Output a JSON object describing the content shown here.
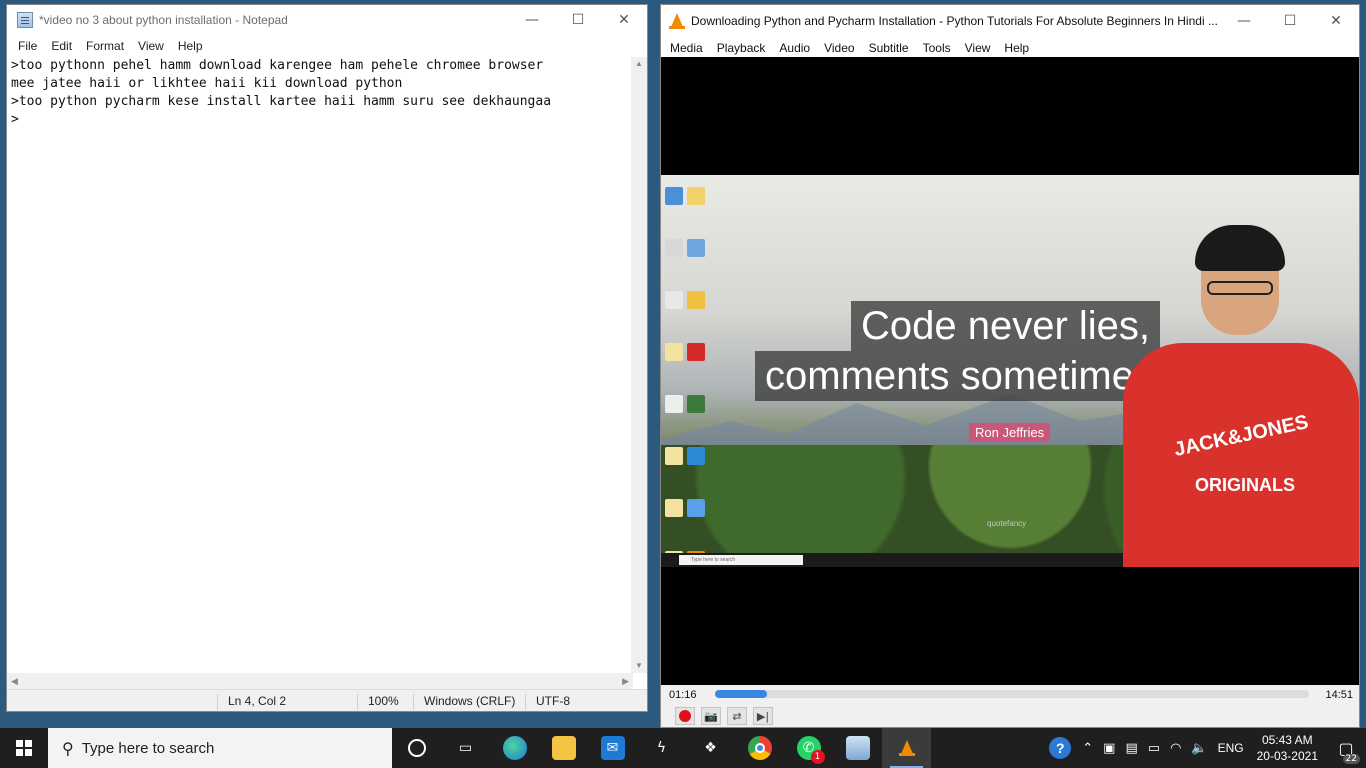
{
  "notepad": {
    "title": "*video no 3 about python installation - Notepad",
    "menu": [
      "File",
      "Edit",
      "Format",
      "View",
      "Help"
    ],
    "content": ">too pythonn pehel hamm download karengee ham pehele chromee browser\nmee jatee haii or likhtee haii kii download python\n>too python pycharm kese install kartee haii hamm suru see dekhaungaa\n>",
    "status": {
      "position": "Ln 4, Col 2",
      "zoom": "100%",
      "line_ending": "Windows (CRLF)",
      "encoding": "UTF-8"
    }
  },
  "vlc": {
    "title": "Downloading Python and Pycharm Installation - Python Tutorials For Absolute Beginners In Hindi ...",
    "menu": [
      "Media",
      "Playback",
      "Audio",
      "Video",
      "Subtitle",
      "Tools",
      "View",
      "Help"
    ],
    "video": {
      "quote_line1": "Code never lies,",
      "quote_line2": "comments sometimes",
      "author": "Ron Jeffries",
      "watermark": "quotefancy",
      "inner_search": "Type here to search",
      "shirt_text": "JACK&JONES",
      "shirt_text2": "ORIGINALS"
    },
    "elapsed": "01:16",
    "duration": "14:51",
    "progress": 0.087
  },
  "taskbar": {
    "search_placeholder": "Type here to search",
    "apps": [
      "cortana",
      "task-view",
      "edge",
      "file-explorer",
      "mail",
      "app",
      "dropbox",
      "chrome",
      "whatsapp",
      "notepad",
      "vlc"
    ],
    "whatsapp_badge": "1",
    "language": "ENG",
    "time": "05:43 AM",
    "date": "20-03-2021",
    "notifications": "22"
  }
}
